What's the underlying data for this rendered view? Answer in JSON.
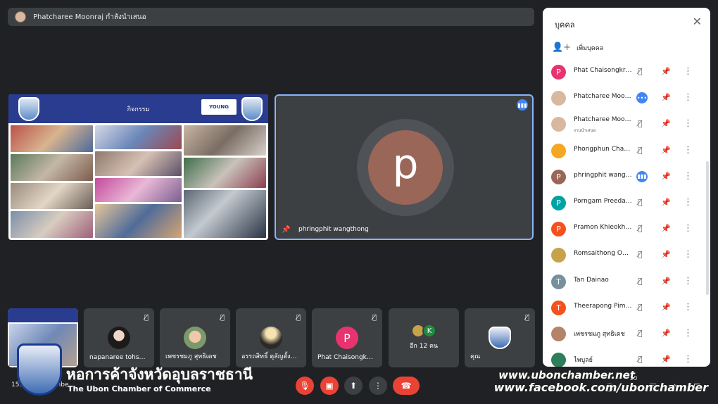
{
  "presenting_bar": {
    "text": "Phatcharee Moonraj กำลังนำเสนอ"
  },
  "slide": {
    "title": "กิจกรรม",
    "badge": "YOUNG"
  },
  "speaker": {
    "initial": "p",
    "name": "phringphit wangthong"
  },
  "filmstrip": [
    {
      "name": "napanaree tohs…",
      "initial": ""
    },
    {
      "name": "เพชรชมภู สุทธิเดช",
      "initial": ""
    },
    {
      "name": "อรรถสิทธิ์ ตุลัญตั้ง…",
      "initial": ""
    },
    {
      "name": "Phat Chaisongk…",
      "initial": "P",
      "color": "#e8336f"
    },
    {
      "name": "อีก 12 คน",
      "initial": "K"
    },
    {
      "name": "คุณ",
      "initial": ""
    }
  ],
  "meeting_code": "15:2… k-ypwi-hbe",
  "panel": {
    "title": "บุคคล",
    "add_people": "เพิ่มบุคคล",
    "people": [
      {
        "name": "Phat Chaisongkram",
        "initial": "P",
        "color": "#e8336f",
        "mic": "off",
        "sub": ""
      },
      {
        "name": "Phatcharee Moon…",
        "initial": "",
        "color": "#d9b8a0",
        "mic": "more",
        "sub": ""
      },
      {
        "name": "Phatcharee Moon…",
        "initial": "",
        "color": "#d9b8a0",
        "mic": "off",
        "sub": "งานนำเสนอ"
      },
      {
        "name": "Phongphun Chant…",
        "initial": "",
        "color": "#f5a623",
        "mic": "off",
        "sub": ""
      },
      {
        "name": "phringphit wangt…",
        "initial": "P",
        "color": "#9a6657",
        "mic": "speaking",
        "sub": ""
      },
      {
        "name": "Porngam Preedas…",
        "initial": "P",
        "color": "#00a3a3",
        "mic": "off",
        "sub": ""
      },
      {
        "name": "Pramon Khieokham",
        "initial": "P",
        "color": "#f4511e",
        "mic": "off",
        "sub": ""
      },
      {
        "name": "Romsaithong Offi…",
        "initial": "",
        "color": "#c8a24a",
        "mic": "off",
        "sub": ""
      },
      {
        "name": "Tan Dainao",
        "initial": "T",
        "color": "#78909c",
        "mic": "off",
        "sub": ""
      },
      {
        "name": "Theerapong Pimp…",
        "initial": "T",
        "color": "#f4511e",
        "mic": "off",
        "sub": ""
      },
      {
        "name": "เพชรชมภู สุทธิเดช",
        "initial": "",
        "color": "#b5826a",
        "mic": "off",
        "sub": ""
      },
      {
        "name": "ไพบูลย์",
        "initial": "",
        "color": "#2e7d5b",
        "mic": "off",
        "sub": ""
      }
    ]
  },
  "watermark": {
    "thai": "หอการค้าจังหวัดอุบลราชธานี",
    "english": "The Ubon Chamber of Commerce",
    "url1": "www.ubonchamber.net",
    "url2": "www.facebook.com/ubonchamber"
  },
  "controls": {
    "participants_count": "20"
  }
}
